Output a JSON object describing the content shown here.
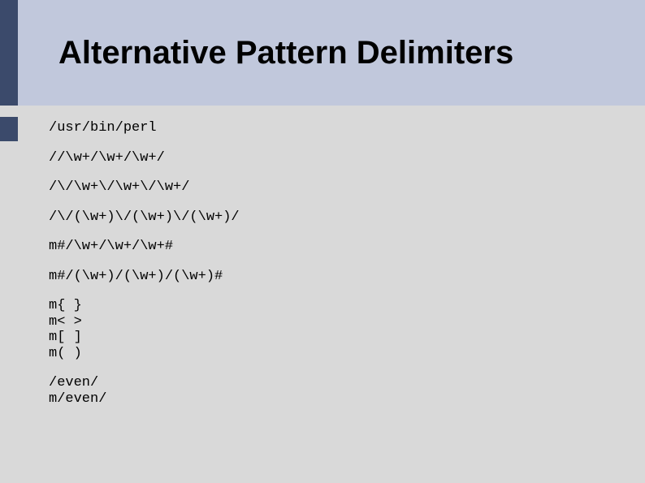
{
  "title": "Alternative Pattern Delimiters",
  "code": {
    "line1": "/usr/bin/perl",
    "line2": "//\\w+/\\w+/\\w+/",
    "line3": "/\\/\\w+\\/\\w+\\/\\w+/",
    "line4": "/\\/(\\w+)\\/(\\w+)\\/(\\w+)/",
    "line5": "m#/\\w+/\\w+/\\w+#",
    "line6": "m#/(\\w+)/(\\w+)/(\\w+)#",
    "line7a": "m{ }",
    "line7b": "m< >",
    "line7c": "m[ ]",
    "line7d": "m( )",
    "line8a": "/even/",
    "line8b": "m/even/"
  }
}
